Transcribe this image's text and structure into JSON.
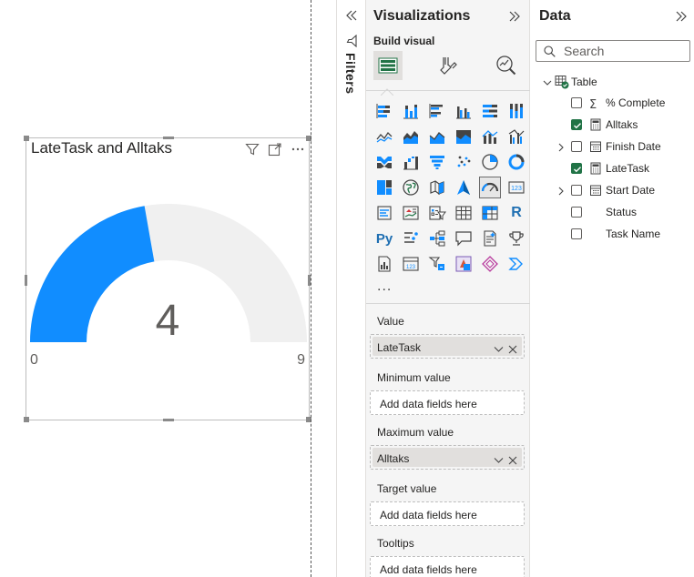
{
  "canvas": {
    "visual": {
      "title": "LateTask and Alltaks",
      "gauge": {
        "value": 4,
        "value_label": "4",
        "min": 0,
        "max": 9,
        "min_label": "0",
        "max_label": "9",
        "fill_color": "#118DFF",
        "track_color": "#F0F0F0"
      },
      "header_icons": [
        "filter-icon",
        "focus-mode-icon",
        "more-options-icon"
      ]
    }
  },
  "filters": {
    "label": "Filters"
  },
  "visualizations": {
    "title": "Visualizations",
    "build_visual_label": "Build visual",
    "build_tabs": [
      "add-data-icon",
      "format-visual-icon",
      "analytics-icon"
    ],
    "more_label": "...",
    "wells": [
      {
        "label": "Value",
        "field": "LateTask"
      },
      {
        "label": "Minimum value",
        "placeholder": "Add data fields here"
      },
      {
        "label": "Maximum value",
        "field": "Alltaks"
      },
      {
        "label": "Target value",
        "placeholder": "Add data fields here"
      },
      {
        "label": "Tooltips",
        "placeholder": "Add data fields here"
      }
    ]
  },
  "data": {
    "title": "Data",
    "search_placeholder": "Search",
    "table": {
      "name": "Table",
      "fields": [
        {
          "name": "% Complete",
          "checked": false,
          "icon": "sigma-icon",
          "expandable": false
        },
        {
          "name": "Alltaks",
          "checked": true,
          "icon": "calculator-icon",
          "expandable": false
        },
        {
          "name": "Finish Date",
          "checked": false,
          "icon": "calendar-icon",
          "expandable": true
        },
        {
          "name": "LateTask",
          "checked": true,
          "icon": "calculator-icon",
          "expandable": false
        },
        {
          "name": "Start Date",
          "checked": false,
          "icon": "calendar-icon",
          "expandable": true
        },
        {
          "name": "Status",
          "checked": false,
          "icon": "",
          "expandable": false
        },
        {
          "name": "Task Name",
          "checked": false,
          "icon": "",
          "expandable": false
        }
      ]
    }
  },
  "colors": {
    "accent_blue": "#118DFF",
    "check_green": "#217346"
  }
}
